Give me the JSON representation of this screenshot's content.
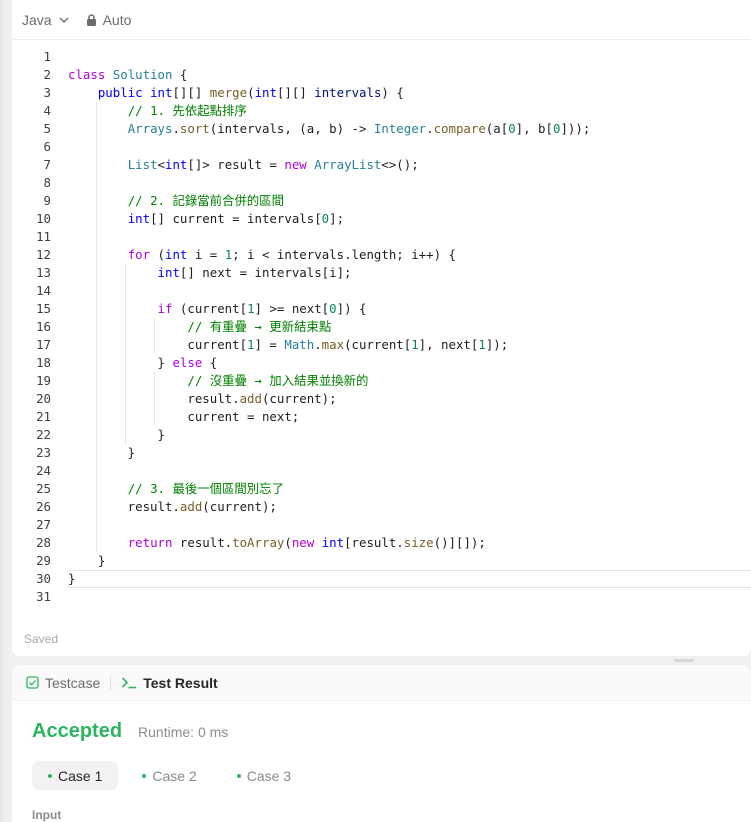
{
  "toolbar": {
    "language": "Java",
    "mode": "Auto",
    "lock_icon": "lock-icon",
    "chevron_icon": "chevron-down-icon"
  },
  "editor": {
    "current_line": 30,
    "lines": [
      {
        "n": "1",
        "g": [],
        "t": []
      },
      {
        "n": "2",
        "g": [],
        "t": [
          [
            "kw2",
            "class"
          ],
          [
            "",
            " "
          ],
          [
            "ty",
            "Solution"
          ],
          [
            "",
            " {"
          ]
        ]
      },
      {
        "n": "3",
        "g": [],
        "t": [
          [
            "",
            "    "
          ],
          [
            "kw",
            "public"
          ],
          [
            "",
            " "
          ],
          [
            "kw",
            "int"
          ],
          [
            "",
            "[][] "
          ],
          [
            "fn",
            "merge"
          ],
          [
            "",
            "("
          ],
          [
            "kw",
            "int"
          ],
          [
            "",
            "[][] "
          ],
          [
            "vr",
            "intervals"
          ],
          [
            "",
            ") {"
          ]
        ]
      },
      {
        "n": "4",
        "g": [
          1
        ],
        "t": [
          [
            "",
            "        "
          ],
          [
            "cm",
            "// 1. 先依起點排序"
          ]
        ]
      },
      {
        "n": "5",
        "g": [
          1
        ],
        "t": [
          [
            "",
            "        "
          ],
          [
            "ty",
            "Arrays"
          ],
          [
            "",
            "."
          ],
          [
            "fn",
            "sort"
          ],
          [
            "",
            "(intervals, (a, b) -> "
          ],
          [
            "ty",
            "Integer"
          ],
          [
            "",
            "."
          ],
          [
            "fn",
            "compare"
          ],
          [
            "",
            "(a["
          ],
          [
            "nm",
            "0"
          ],
          [
            "",
            "], b["
          ],
          [
            "nm",
            "0"
          ],
          [
            "",
            "]));"
          ]
        ]
      },
      {
        "n": "6",
        "g": [
          1
        ],
        "t": []
      },
      {
        "n": "7",
        "g": [
          1
        ],
        "t": [
          [
            "",
            "        "
          ],
          [
            "ty",
            "List"
          ],
          [
            "",
            "<"
          ],
          [
            "kw",
            "int"
          ],
          [
            "",
            "[]> result = "
          ],
          [
            "kw2",
            "new"
          ],
          [
            "",
            " "
          ],
          [
            "ty",
            "ArrayList"
          ],
          [
            "",
            "<>();"
          ]
        ]
      },
      {
        "n": "8",
        "g": [
          1
        ],
        "t": []
      },
      {
        "n": "9",
        "g": [
          1
        ],
        "t": [
          [
            "",
            "        "
          ],
          [
            "cm",
            "// 2. 記錄當前合併的區間"
          ]
        ]
      },
      {
        "n": "10",
        "g": [
          1
        ],
        "t": [
          [
            "",
            "        "
          ],
          [
            "kw",
            "int"
          ],
          [
            "",
            "[] current = intervals["
          ],
          [
            "nm",
            "0"
          ],
          [
            "",
            "];"
          ]
        ]
      },
      {
        "n": "11",
        "g": [
          1
        ],
        "t": []
      },
      {
        "n": "12",
        "g": [
          1
        ],
        "t": [
          [
            "",
            "        "
          ],
          [
            "kw2",
            "for"
          ],
          [
            "",
            " ("
          ],
          [
            "kw",
            "int"
          ],
          [
            "",
            " i = "
          ],
          [
            "nm",
            "1"
          ],
          [
            "",
            "; i < intervals.length; i++) {"
          ]
        ]
      },
      {
        "n": "13",
        "g": [
          1,
          2
        ],
        "t": [
          [
            "",
            "            "
          ],
          [
            "kw",
            "int"
          ],
          [
            "",
            "[] next = intervals[i];"
          ]
        ]
      },
      {
        "n": "14",
        "g": [
          1,
          2
        ],
        "t": []
      },
      {
        "n": "15",
        "g": [
          1,
          2
        ],
        "t": [
          [
            "",
            "            "
          ],
          [
            "kw2",
            "if"
          ],
          [
            "",
            " (current["
          ],
          [
            "nm",
            "1"
          ],
          [
            "",
            "] >= next["
          ],
          [
            "nm",
            "0"
          ],
          [
            "",
            "]) {"
          ]
        ]
      },
      {
        "n": "16",
        "g": [
          1,
          2,
          3
        ],
        "t": [
          [
            "",
            "                "
          ],
          [
            "cm",
            "// 有重疊 → 更新結束點"
          ]
        ]
      },
      {
        "n": "17",
        "g": [
          1,
          2,
          3
        ],
        "t": [
          [
            "",
            "                "
          ],
          [
            "",
            "current["
          ],
          [
            "nm",
            "1"
          ],
          [
            "",
            "] = "
          ],
          [
            "ty",
            "Math"
          ],
          [
            "",
            "."
          ],
          [
            "fn",
            "max"
          ],
          [
            "",
            "(current["
          ],
          [
            "nm",
            "1"
          ],
          [
            "",
            "], next["
          ],
          [
            "nm",
            "1"
          ],
          [
            "",
            "]);"
          ]
        ]
      },
      {
        "n": "18",
        "g": [
          1,
          2
        ],
        "t": [
          [
            "",
            "            } "
          ],
          [
            "kw2",
            "else"
          ],
          [
            "",
            " {"
          ]
        ]
      },
      {
        "n": "19",
        "g": [
          1,
          2,
          3
        ],
        "t": [
          [
            "",
            "                "
          ],
          [
            "cm",
            "// 沒重疊 → 加入結果並換新的"
          ]
        ]
      },
      {
        "n": "20",
        "g": [
          1,
          2,
          3
        ],
        "t": [
          [
            "",
            "                result."
          ],
          [
            "fn",
            "add"
          ],
          [
            "",
            "(current);"
          ]
        ]
      },
      {
        "n": "21",
        "g": [
          1,
          2,
          3
        ],
        "t": [
          [
            "",
            "                current = next;"
          ]
        ]
      },
      {
        "n": "22",
        "g": [
          1,
          2
        ],
        "t": [
          [
            "",
            "            }"
          ]
        ]
      },
      {
        "n": "23",
        "g": [
          1
        ],
        "t": [
          [
            "",
            "        }"
          ]
        ]
      },
      {
        "n": "24",
        "g": [
          1
        ],
        "t": []
      },
      {
        "n": "25",
        "g": [
          1
        ],
        "t": [
          [
            "",
            "        "
          ],
          [
            "cm",
            "// 3. 最後一個區間別忘了"
          ]
        ]
      },
      {
        "n": "26",
        "g": [
          1
        ],
        "t": [
          [
            "",
            "        result."
          ],
          [
            "fn",
            "add"
          ],
          [
            "",
            "(current);"
          ]
        ]
      },
      {
        "n": "27",
        "g": [
          1
        ],
        "t": []
      },
      {
        "n": "28",
        "g": [
          1
        ],
        "t": [
          [
            "",
            "        "
          ],
          [
            "kw2",
            "return"
          ],
          [
            "",
            " result."
          ],
          [
            "fn",
            "toArray"
          ],
          [
            "",
            "("
          ],
          [
            "kw2",
            "new"
          ],
          [
            "",
            " "
          ],
          [
            "kw",
            "int"
          ],
          [
            "",
            "[result."
          ],
          [
            "fn",
            "size"
          ],
          [
            "",
            "()][]);"
          ]
        ]
      },
      {
        "n": "29",
        "g": [],
        "t": [
          [
            "",
            "    }"
          ]
        ]
      },
      {
        "n": "30",
        "g": [],
        "t": [
          [
            "",
            "}"
          ]
        ]
      },
      {
        "n": "31",
        "g": [],
        "t": []
      }
    ],
    "saved_label": "Saved"
  },
  "result": {
    "tabs": [
      {
        "label": "Testcase",
        "icon": "checkbox-icon",
        "active": false
      },
      {
        "label": "Test Result",
        "icon": "terminal-icon",
        "active": true
      }
    ],
    "status": "Accepted",
    "runtime": "Runtime: 0 ms",
    "cases": [
      "Case 1",
      "Case 2",
      "Case 3"
    ],
    "active_case": 0,
    "input_label": "Input",
    "accent": "#2db55d"
  }
}
